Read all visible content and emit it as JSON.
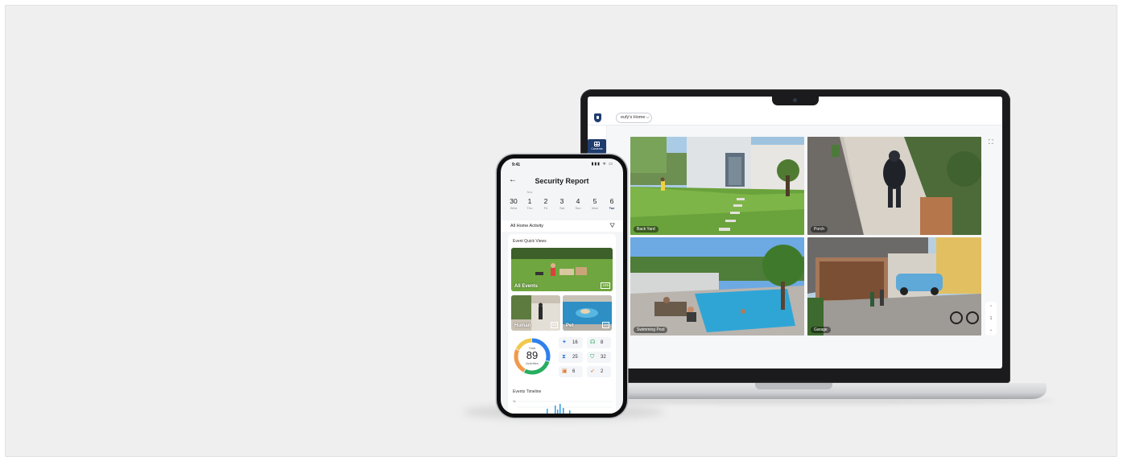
{
  "laptop_app": {
    "home_selector": "eufy's Home",
    "sidebar_button": "Cameras",
    "cameras": [
      {
        "label": "Back Yard"
      },
      {
        "label": "Porch"
      },
      {
        "label": "Swimming Pool"
      },
      {
        "label": "Garage"
      }
    ],
    "pager": {
      "up": "⌃",
      "page": "1",
      "down": "⌄"
    }
  },
  "phone_app": {
    "status_time": "9:41",
    "status_icons": "▮▮▮ ᯤ ▭",
    "title": "Security Report",
    "month_label": "Nov",
    "dates": [
      {
        "num": "30",
        "day": "Wed"
      },
      {
        "num": "1",
        "day": "Thu"
      },
      {
        "num": "2",
        "day": "Fri"
      },
      {
        "num": "3",
        "day": "Sat"
      },
      {
        "num": "4",
        "day": "Sun"
      },
      {
        "num": "5",
        "day": "Mon"
      },
      {
        "num": "6",
        "day": "Tue"
      }
    ],
    "activity_label": "All Home Activity",
    "quick_views_label": "Event Quick Views",
    "quick_views": {
      "all": {
        "label": "All Events",
        "count": "159"
      },
      "human": {
        "label": "Human",
        "count": "60"
      },
      "pet": {
        "label": "Pet",
        "count": "24"
      }
    },
    "total": {
      "label": "Total",
      "value": "89",
      "sub": "Activities"
    },
    "donut_colors": [
      "#2f80ed",
      "#27ae60",
      "#f2994a",
      "#f2c94c"
    ],
    "stats": [
      {
        "icon": "person-icon",
        "glyph": "✦",
        "value": "16",
        "color": "#3b7bd9"
      },
      {
        "icon": "car-icon",
        "glyph": "☊",
        "value": "8",
        "color": "#27ae60"
      },
      {
        "icon": "wave-icon",
        "glyph": "⧗",
        "value": "25",
        "color": "#3b7bd9"
      },
      {
        "icon": "shield-icon",
        "glyph": "⛉",
        "value": "32",
        "color": "#27ae60"
      },
      {
        "icon": "package-icon",
        "glyph": "▣",
        "value": "6",
        "color": "#e07a3a"
      },
      {
        "icon": "paw-icon",
        "glyph": "➶",
        "value": "2",
        "color": "#e07a3a"
      }
    ],
    "timeline_label": "Events Timeline",
    "timeline_axis": "9k"
  }
}
